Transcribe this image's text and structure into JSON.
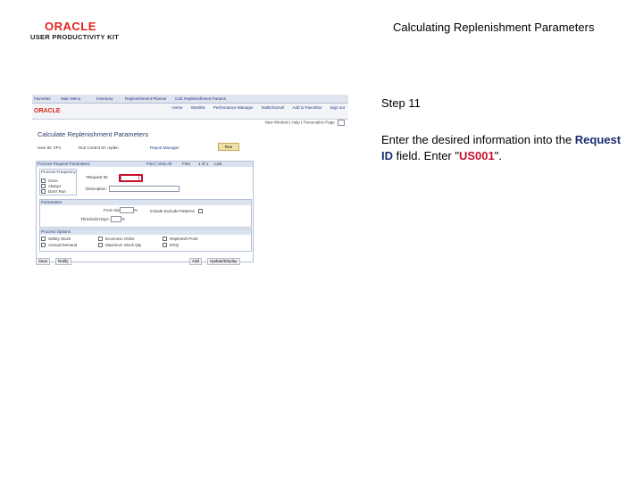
{
  "header": {
    "logo_main": "ORACLE",
    "logo_sub": "USER PRODUCTIVITY KIT",
    "title": "Calculating Replenishment Parameters"
  },
  "step": {
    "label": "Step 11",
    "instruction_prefix": "Enter the desired information into the ",
    "field_name": "Request ID",
    "instruction_middle": " field. Enter \"",
    "value": "US001",
    "instruction_suffix": "\"."
  },
  "colors": {
    "brand_red": "#e2231a",
    "highlight": "#c8102e",
    "field_blue": "#1c2d74"
  },
  "screenshot": {
    "breadcrumbs": [
      "Favorites",
      "Main Menu",
      "Inventory",
      "Replenishment Planner",
      "Calc Replenishment Params"
    ],
    "brand": "ORACLE",
    "nav_links": [
      "Home",
      "Worklist",
      "Performance Manager",
      "Multichannel",
      "Add to Favorites",
      "Sign out"
    ],
    "util_links": "New Window | Help | Personalize Page",
    "page_title": "Calculate Replenishment Parameters",
    "user_id_label": "User ID: VP1",
    "run_control_label": "Run Control ID: replen",
    "report_manager": "Report Manager",
    "run_button": "Run",
    "group_title": "Process Request Parameters",
    "find_label": "Find | View All",
    "first_label": "First",
    "paging": "1 of 1",
    "last_label": "Last",
    "process_freq_label": "Process Frequency",
    "freq_options": [
      "Once",
      "Always",
      "Don't Run"
    ],
    "request_id_label": "*Request ID:",
    "description_label": "Description:",
    "parameters_title": "Parameters",
    "from_date_label": "From Date:",
    "include_label": "Include Exclude Patterns",
    "threshold_label": "Threshold Days:",
    "percent_symbol": "%",
    "options_title": "Process Options",
    "options": [
      "Safety Stock",
      "Economic Order",
      "Replenish Point",
      "Annual Demand",
      "Maximum Stock Qty",
      "EOQ"
    ],
    "bottom_left": [
      "Save",
      "Notify"
    ],
    "bottom_right": [
      "Add",
      "Update/Display"
    ]
  }
}
